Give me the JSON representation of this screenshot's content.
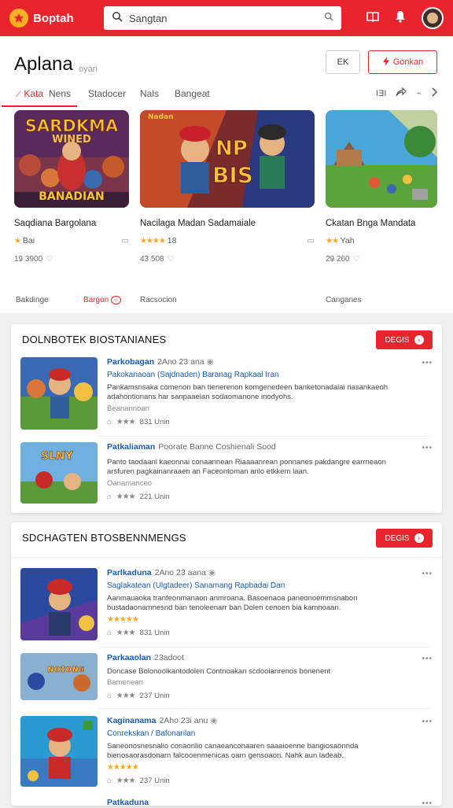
{
  "topbar": {
    "logo_text": "Boptah",
    "search_value": "Sangtan",
    "colors": {
      "brand": "#e8252d"
    }
  },
  "header": {
    "title": "Aplana",
    "subtitle": "oyan",
    "btn1_label": "EK",
    "btn2_label": "Gonkan"
  },
  "tabs": [
    {
      "label": "Kata"
    },
    {
      "label": "Nens"
    },
    {
      "label": "Stadocer"
    },
    {
      "label": "Nals"
    },
    {
      "label": "Bangeat"
    }
  ],
  "tab_tools": {
    "count": "ӀƎӀ"
  },
  "featured": [
    {
      "thumb_text_top": "SARDKMA",
      "thumb_text_mid": "WINED",
      "thumb_text_bottom": "BANADIAN",
      "title": "Saqdiana Bargolana",
      "rating": "Bai",
      "stat": "19 3900",
      "foot": "Bakdinge",
      "foot_right": "Bargon"
    },
    {
      "thumb_text_top": "Nadan",
      "thumb_text_mid": "NP",
      "thumb_text_bottom": "BIS",
      "title": "Nacilaga Madan Sadamaiale",
      "rating": "18",
      "stat": "43 508",
      "foot": "Racsocion",
      "foot_right": ""
    },
    {
      "thumb_text_top": "",
      "thumb_text_mid": "",
      "thumb_text_bottom": "",
      "title": "Ckatan Bnga Mandata",
      "rating": "Yah",
      "stat": "29 260",
      "foot": "Canganes",
      "foot_right": ""
    }
  ],
  "section1": {
    "title": "DOLNBOTEK BIOSTANIANES",
    "button_label": "DEGIS",
    "items": [
      {
        "title": "Parkobagan",
        "date": "2Ano 23 ana",
        "sub": "Pakokanaoan (Sajdnaden) Baranag Rapkaal Iran",
        "desc": "Pankamsnsaka comenon ban tienerenon komgenedeen banketonadalai nasankaeoh adahontionans har sanpaaeian sodaomanone inodyohs.",
        "tag": "Beanannoan",
        "meta": "831 Unin"
      },
      {
        "title": "Patkaliaman",
        "date": "Poorate Banne Coshienali Sood",
        "sub": "",
        "desc": "Panto taodaanl kaeonnai conaannean Riaaaanrean ponnanes pakdangre earrneaon arsfuren pagkainanraaen an Faceontoman anlo etkkem laan.",
        "tag": "Oanamanceo",
        "meta": "221 Unin"
      }
    ]
  },
  "section2": {
    "title": "SDCHAGTEN BTOSBENNMENGS",
    "button_label": "DEGIS",
    "items": [
      {
        "title": "Parlkaduna",
        "date": "2Ano 23 aana",
        "sub": "Saglakatean (Ulgtadeer) Sanamang Rapbadai Dan",
        "desc": "Aanmauaoka tranfeonmanaon anmroana. Basoenaoa paneonoemmsnabon bustadaonamnesnd ban tenoleenarr ban Dolen cenoen bia kamnoaan.",
        "tag": "",
        "meta": "831 Unin"
      },
      {
        "title": "Parkaaolan",
        "date": "23adoot",
        "sub": "",
        "desc": "Doncase Bolonoolkantodolen Contnoakan scdooianrenos bonenent",
        "tag": "Bamenean",
        "meta": "237 Unin"
      },
      {
        "title": "Kaginanama",
        "date": "2Aho 23i anu",
        "sub": "Conrekskan / Bafonarilan",
        "desc": "Saneonosnesnalio conaonlio canaeanconaaren saaaioenne bangiosaonnda bienosaorasdonarn falcooenmenicas oarn gensoaon. Nahk aun ladeab.",
        "tag": "",
        "meta": "237 Unin"
      },
      {
        "title": "Patkaduna",
        "date": "",
        "sub": "",
        "desc": "",
        "tag": "",
        "meta": ""
      }
    ]
  }
}
